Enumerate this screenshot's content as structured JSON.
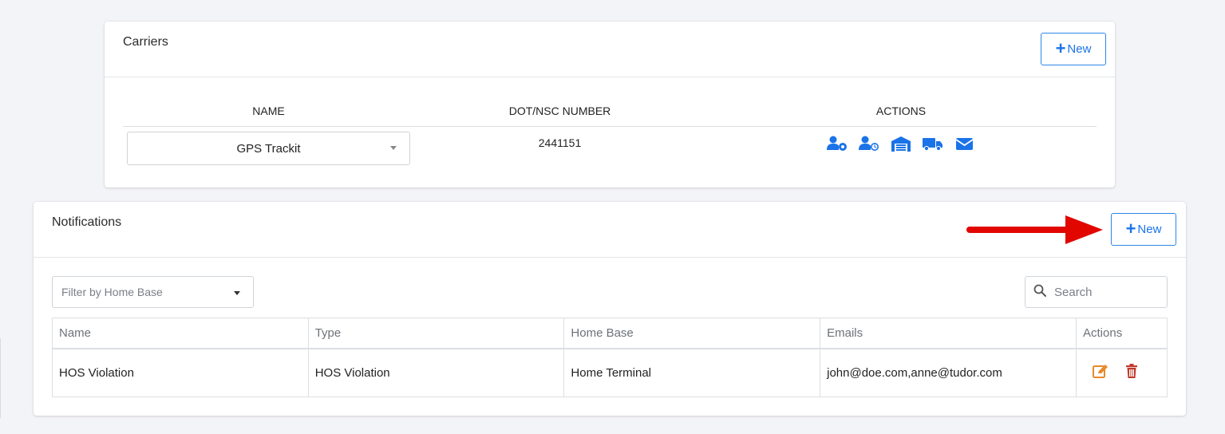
{
  "carriers": {
    "title": "Carriers",
    "new_label": "New",
    "columns": [
      "NAME",
      "DOT/NSC NUMBER",
      "ACTIONS"
    ],
    "selected_carrier": "GPS Trackit",
    "dot_number": "2441151",
    "action_icons": [
      "user-gear-icon",
      "user-clock-icon",
      "warehouse-icon",
      "truck-icon",
      "envelope-icon"
    ],
    "icon_color": "#1a73e8"
  },
  "notifications": {
    "title": "Notifications",
    "new_label": "New",
    "filter_placeholder": "Filter by Home Base",
    "search_placeholder": "Search",
    "columns": [
      "Name",
      "Type",
      "Home Base",
      "Emails",
      "Actions"
    ],
    "rows": [
      {
        "name": "HOS Violation",
        "type": "HOS Violation",
        "home_base": "Home Terminal",
        "emails": "john@doe.com,anne@tudor.com",
        "actions": [
          "edit-icon",
          "trash-icon"
        ]
      }
    ],
    "edit_color": "#e8892b",
    "delete_color": "#c0392b"
  },
  "annotation": {
    "arrow_color": "#e10600"
  }
}
